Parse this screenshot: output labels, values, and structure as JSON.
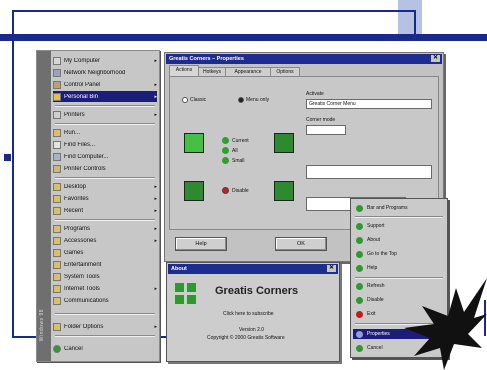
{
  "start_menu": {
    "brand_text": "Windows 98",
    "items": [
      {
        "label": "My Computer",
        "icon": "computer-icon",
        "arrow": "▸"
      },
      {
        "label": "Network Neighborhood",
        "icon": "network-icon",
        "arrow": ""
      },
      {
        "label": "Control Panel",
        "icon": "control-panel-icon",
        "arrow": "▸"
      },
      {
        "label": "Personal Bin",
        "icon": "folder-icon",
        "arrow": "▸"
      },
      {
        "label": "Printers",
        "icon": "printer-icon",
        "arrow": "▸"
      },
      {
        "label": "Run...",
        "icon": "run-icon",
        "arrow": ""
      },
      {
        "label": "Find Files...",
        "icon": "find-files-icon",
        "arrow": ""
      },
      {
        "label": "Find Computer...",
        "icon": "find-computer-icon",
        "arrow": ""
      },
      {
        "label": "Printer Controls",
        "icon": "printer-controls-icon",
        "arrow": ""
      },
      {
        "label": "Desktop",
        "icon": "desktop-icon",
        "arrow": "▸"
      },
      {
        "label": "Favorites",
        "icon": "favorites-icon",
        "arrow": "▸"
      },
      {
        "label": "Recent",
        "icon": "recent-icon",
        "arrow": "▸"
      },
      {
        "label": "Programs",
        "icon": "programs-icon",
        "arrow": "▸"
      },
      {
        "label": "Accessories",
        "icon": "accessories-icon",
        "arrow": "▸"
      },
      {
        "label": "Games",
        "icon": "games-icon",
        "arrow": ""
      },
      {
        "label": "Entertainment",
        "icon": "entertainment-icon",
        "arrow": ""
      },
      {
        "label": "System Tools",
        "icon": "system-tools-icon",
        "arrow": ""
      },
      {
        "label": "Internet Tools",
        "icon": "internet-tools-icon",
        "arrow": "▸"
      },
      {
        "label": "Communications",
        "icon": "communications-icon",
        "arrow": ""
      },
      {
        "label": "Folder Options",
        "icon": "folder-options-icon",
        "arrow": "▸"
      },
      {
        "label": "Cancel",
        "icon": "cancel-icon",
        "arrow": ""
      }
    ]
  },
  "dialog": {
    "title": "Greatis Corners – Properties",
    "close_glyph": "✕",
    "tabs": [
      "Actions",
      "Hotkeys",
      "Appearance",
      "Options"
    ],
    "activate_label": "Activate",
    "activate_value": "Greatis Corner Menu",
    "radio_left": "Classic",
    "radio_right": "Menu only",
    "opt_current": "Current",
    "opt_all": "All",
    "opt_small": "Small",
    "opt_disable": "Disable",
    "corner_mode_label": "Corner mode",
    "ok_label": "OK",
    "help_label": "Help"
  },
  "about": {
    "title": "About",
    "close_glyph": "✕",
    "product": "Greatis Corners",
    "tagline": "Click here to subscribe",
    "version": "Version 2.0",
    "copyright": "Copyright © 2000 Greatis Software"
  },
  "context_menu": {
    "items": [
      {
        "label": "Bar and Programs"
      },
      {
        "label": "Support"
      },
      {
        "label": "About"
      },
      {
        "label": "Go to the Top"
      },
      {
        "label": "Help"
      },
      {
        "label": "Refresh"
      },
      {
        "label": "Disable"
      },
      {
        "label": "Exit"
      },
      {
        "label": "Properties"
      },
      {
        "label": "Cancel"
      }
    ]
  },
  "colors": {
    "accent": "#1a2a8a",
    "highlight": "#1c1c7a",
    "green": "#2e9a2e"
  }
}
